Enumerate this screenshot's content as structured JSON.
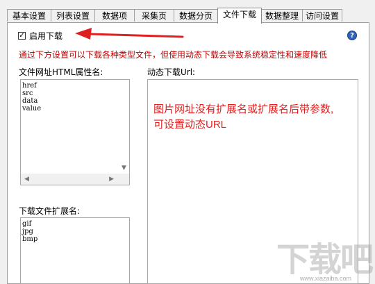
{
  "tabs": [
    {
      "label": "基本设置"
    },
    {
      "label": "列表设置"
    },
    {
      "label": "数据项"
    },
    {
      "label": "采集页"
    },
    {
      "label": "数据分页"
    },
    {
      "label": "文件下载"
    },
    {
      "label": "数据整理"
    },
    {
      "label": "访问设置"
    }
  ],
  "download": {
    "enable_label": "启用下载",
    "enabled": true,
    "checkbox_glyph": "✓",
    "help_glyph": "?",
    "notice": "通过下方设置可以下载各种类型文件，但使用动态下载会导致系统稳定性和速度降低"
  },
  "attr_panel": {
    "label": "文件网址HTML属性名:",
    "items": [
      "href",
      "src",
      "data",
      "value"
    ]
  },
  "ext_panel": {
    "label": "下载文件扩展名:",
    "items": [
      "gif",
      "jpg",
      "bmp"
    ]
  },
  "dynamic_panel": {
    "label": "动态下载Url:",
    "annotation_line1": "图片网址没有扩展名或扩展名后带参数,",
    "annotation_line2": "可设置动态URL"
  },
  "watermark": {
    "text": "下载吧",
    "url": "www.xiazaiba.com"
  },
  "colors": {
    "notice": "#c00000",
    "annotation": "#e02020",
    "arrow": "#e02020"
  }
}
